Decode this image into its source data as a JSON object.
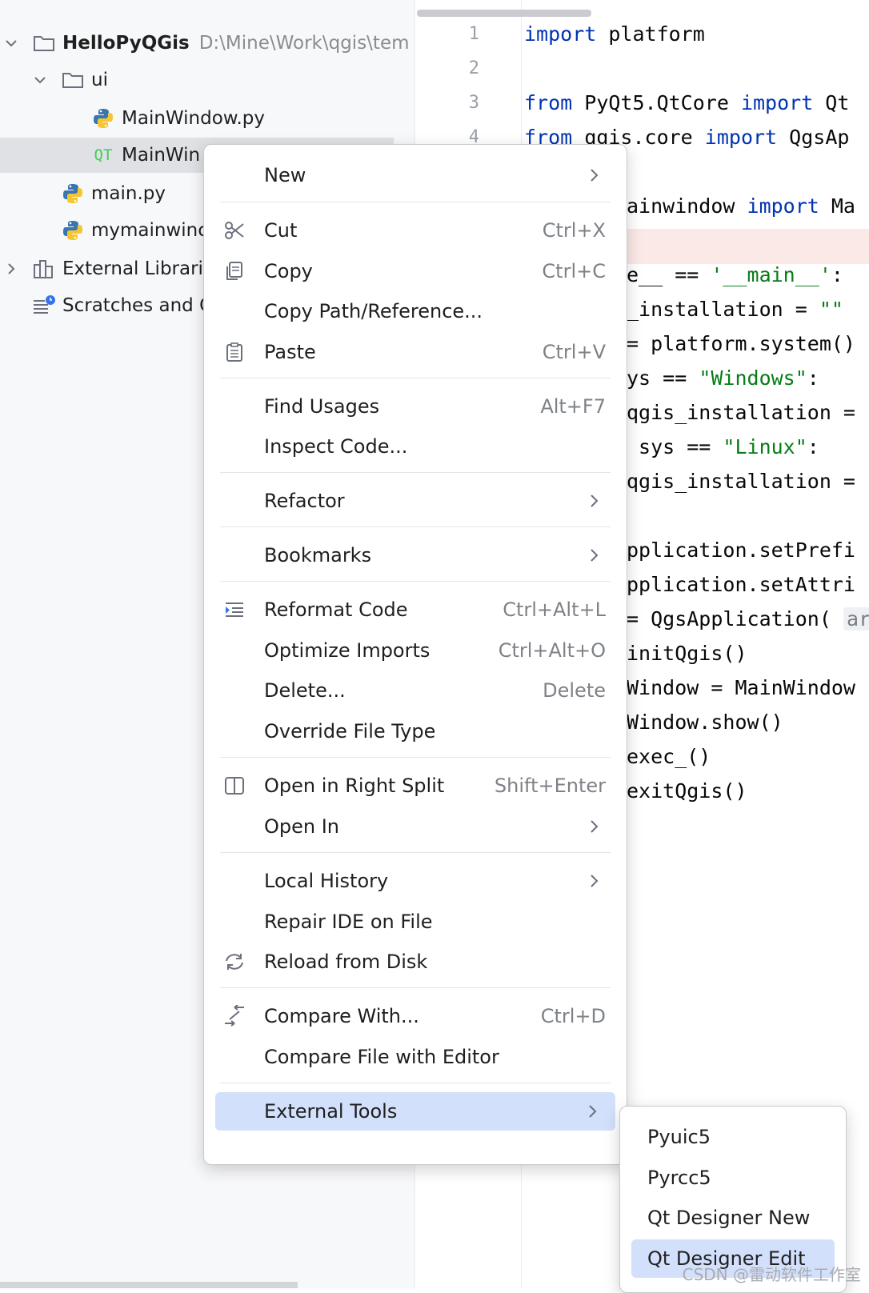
{
  "tree": {
    "project_name": "HelloPyQGis",
    "project_path": "D:\\Mine\\Work\\qgis\\tem",
    "folder_ui": "ui",
    "file_mainwindow_py": "MainWindow.py",
    "file_mainwindow_ui": "MainWin",
    "file_main_py": "main.py",
    "file_mymainwindow": "mymainwinc",
    "external_libraries": "External Librarie",
    "scratches": "Scratches and C",
    "qt_badge": "QT"
  },
  "editor": {
    "line_numbers": [
      "1",
      "2",
      "3",
      "4"
    ],
    "line1": {
      "kw": "import",
      "rest": " platform"
    },
    "line3": {
      "kw1": "from",
      "mid": " PyQt5.QtCore ",
      "kw2": "import",
      "rest": " Qt"
    },
    "line4": {
      "kw1": "from",
      "mid": " qgis.core ",
      "kw2": "import",
      "rest": " QgsAp"
    },
    "line6": {
      "rest": "ainwindow ",
      "kw": "import",
      "tail": " Ma"
    },
    "line8": {
      "a": "e__ == ",
      "s": "'__main__'",
      "b": ":"
    },
    "line9": {
      "a": "_installation = ",
      "s": "\"\""
    },
    "line10": "= platform.system()",
    "line11": {
      "a": "ys == ",
      "s": "\"Windows\"",
      "b": ":"
    },
    "line12": "qgis_installation =",
    "line13": {
      "a": " sys == ",
      "s": "\"Linux\"",
      "b": ":"
    },
    "line14": "qgis_installation =",
    "line16": "pplication.setPrefi",
    "line17": "pplication.setAttri",
    "line18": {
      "a": "= QgsApplication( ",
      "hint": "ar"
    },
    "line19": "initQgis()",
    "line20": "Window = MainWindow",
    "line21": "Window.show()",
    "line22": "exec_()",
    "line23": "exitQgis()"
  },
  "menu": {
    "new": "New",
    "cut": "Cut",
    "cut_sc": "Ctrl+X",
    "copy": "Copy",
    "copy_sc": "Ctrl+C",
    "copy_path": "Copy Path/Reference...",
    "paste": "Paste",
    "paste_sc": "Ctrl+V",
    "find_usages": "Find Usages",
    "find_usages_sc": "Alt+F7",
    "inspect_code": "Inspect Code...",
    "refactor": "Refactor",
    "bookmarks": "Bookmarks",
    "reformat_code": "Reformat Code",
    "reformat_code_sc": "Ctrl+Alt+L",
    "optimize_imports": "Optimize Imports",
    "optimize_imports_sc": "Ctrl+Alt+O",
    "delete": "Delete...",
    "delete_sc": "Delete",
    "override_file_type": "Override File Type",
    "open_right_split": "Open in Right Split",
    "open_right_split_sc": "Shift+Enter",
    "open_in": "Open In",
    "local_history": "Local History",
    "repair_ide": "Repair IDE on File",
    "reload_disk": "Reload from Disk",
    "compare_with": "Compare With...",
    "compare_with_sc": "Ctrl+D",
    "compare_editor": "Compare File with Editor",
    "external_tools": "External Tools"
  },
  "submenu": {
    "pyuic5": "Pyuic5",
    "pyrcc5": "Pyrcc5",
    "qt_designer_new": "Qt Designer New",
    "qt_designer_edit": "Qt Designer Edit"
  },
  "watermark": "CSDN @雷动软件工作室",
  "colors": {
    "keyword": "#0033b3",
    "string": "#067d17",
    "selection": "#d3e0fb"
  }
}
